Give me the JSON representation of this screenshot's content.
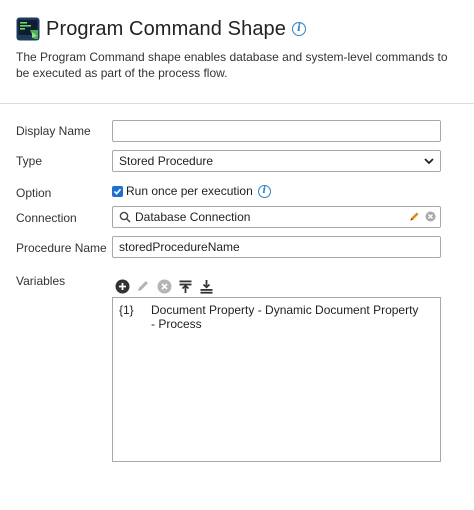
{
  "header": {
    "title": "Program Command Shape",
    "description": "The Program Command shape enables database and system-level commands to be executed as part of the process flow."
  },
  "form": {
    "display_name": {
      "label": "Display Name",
      "value": ""
    },
    "type": {
      "label": "Type",
      "value": "Stored Procedure"
    },
    "option": {
      "label": "Option",
      "checkbox_label": "Run once per execution",
      "checked": true
    },
    "connection": {
      "label": "Connection",
      "value": "Database Connection"
    },
    "procedure_name": {
      "label": "Procedure Name",
      "value": "storedProcedureName"
    },
    "variables": {
      "label": "Variables",
      "items": [
        {
          "key": "{1}",
          "value": "Document Property - Dynamic Document Property - Process"
        }
      ]
    }
  },
  "icons": [
    "program-command-shape-icon",
    "info-icon",
    "chevron-down-icon",
    "checkmark-icon",
    "search-icon",
    "pencil-icon",
    "clear-icon",
    "add-icon",
    "edit-icon",
    "delete-icon",
    "move-to-top-icon",
    "move-to-bottom-icon"
  ],
  "colors": {
    "accent_blue": "#2f7fc1",
    "checkbox_blue": "#1e6fd0",
    "pencil_orange": "#e08a1c",
    "icon_dark": "#3a3a3a",
    "icon_disabled": "#b5b5b5"
  }
}
